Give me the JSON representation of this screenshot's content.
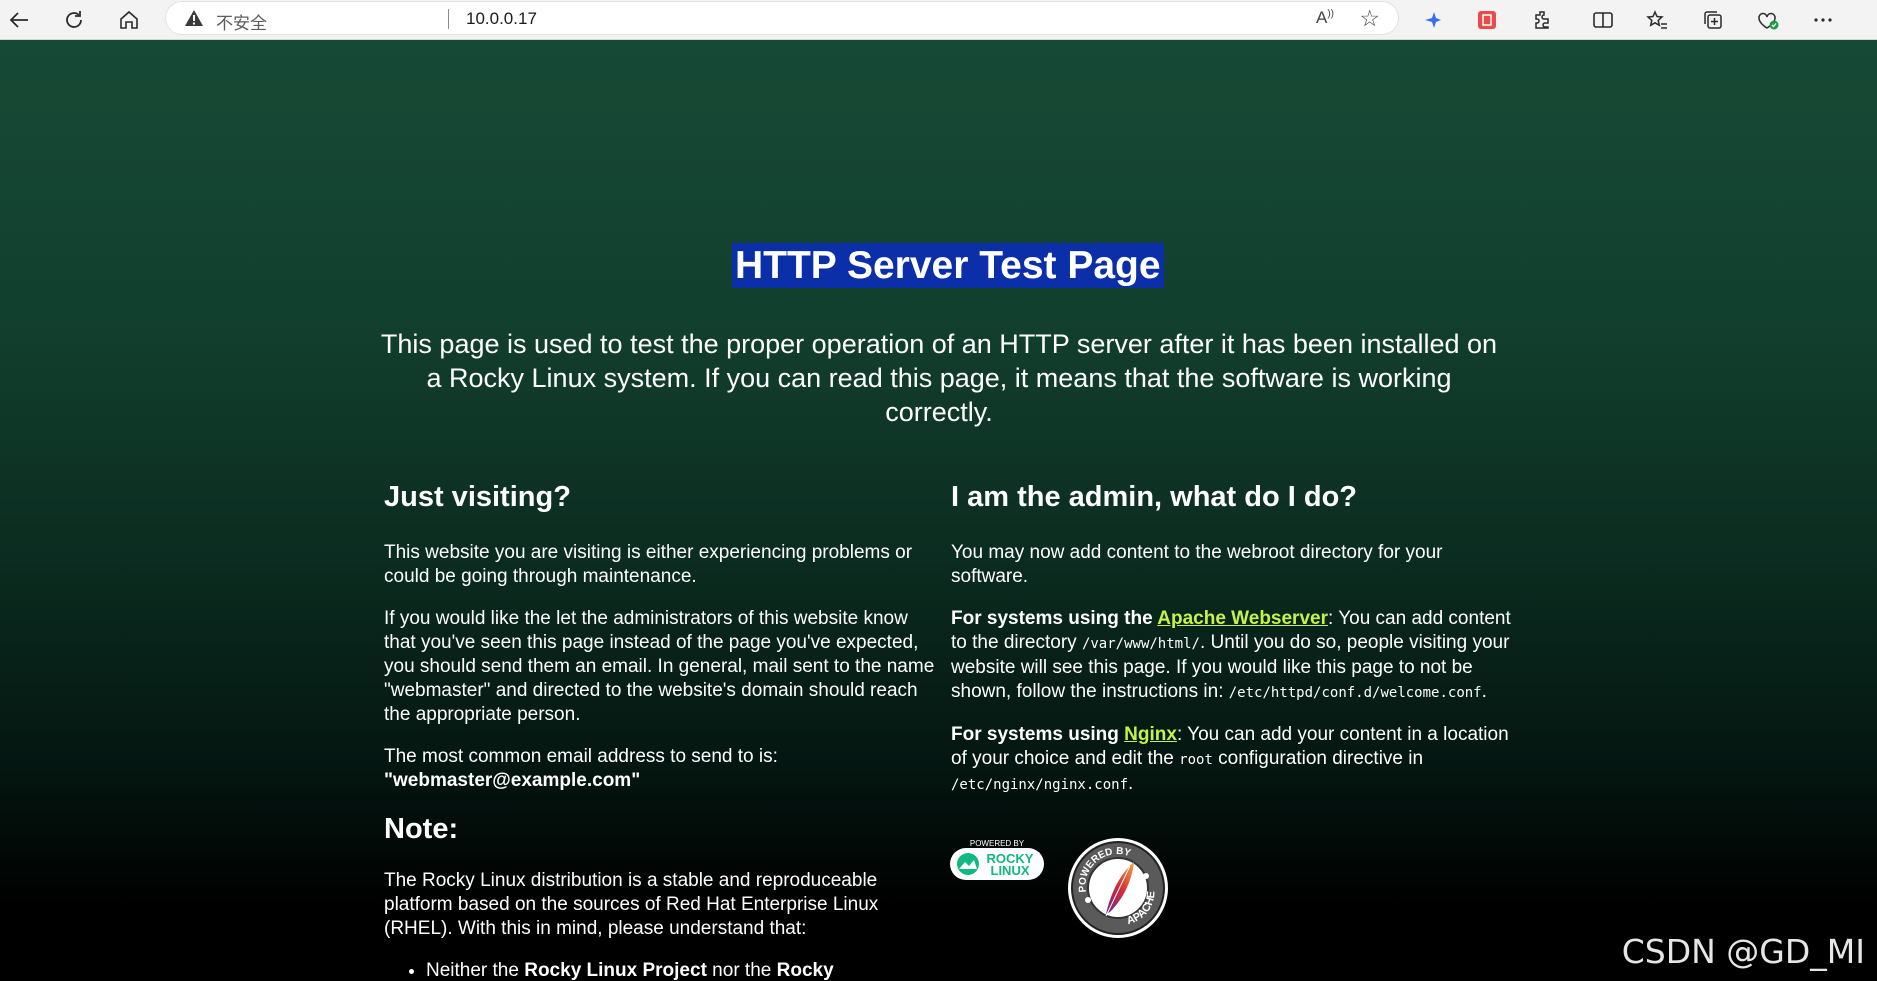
{
  "browser": {
    "security_label": "不安全",
    "url": "10.0.0.17",
    "read_aloud_label": "A",
    "icons": [
      "back-icon",
      "refresh-icon",
      "home-icon",
      "warning-icon",
      "read-aloud-icon",
      "favorite-star-icon",
      "extension-blue-icon",
      "extension-red-icon",
      "extensions-icon",
      "split-screen-icon",
      "favorites-icon",
      "collections-icon",
      "browser-essentials-icon",
      "more-icon"
    ]
  },
  "page": {
    "title": "HTTP Server Test Page",
    "intro": "This page is used to test the proper operation of an HTTP server after it has been installed on a Rocky Linux system. If you can read this page, it means that the software is working correctly.",
    "left": {
      "heading": "Just visiting?",
      "p1": "This website you are visiting is either experiencing problems or could be going through maintenance.",
      "p2": "If you would like the let the administrators of this website know that you've seen this page instead of the page you've expected, you should send them an email. In general, mail sent to the name \"webmaster\" and directed to the website's domain should reach the appropriate person.",
      "p3_lead": "The most common email address to send to is:",
      "email": "\"webmaster@example.com\"",
      "note_heading": "Note:",
      "note_p": "The Rocky Linux distribution is a stable and reproduceable platform based on the sources of Red Hat Enterprise Linux (RHEL). With this in mind, please understand that:",
      "bullet_1_a": "Neither the ",
      "bullet_1_b": "Rocky Linux Project",
      "bullet_1_c": " nor the ",
      "bullet_1_d": "Rocky"
    },
    "right": {
      "heading": "I am the admin, what do I do?",
      "p1": "You may now add content to the webroot directory for your software.",
      "apache_lead": "For systems using the ",
      "apache_link": "Apache Webserver",
      "apache_text_1": ": You can add content to the directory ",
      "apache_dir": "/var/www/html/",
      "apache_text_2": ". Until you do so, people visiting your website will see this page. If you would like this page to not be shown, follow the instructions in: ",
      "apache_conf": "/etc/httpd/conf.d/welcome.conf",
      "apache_end": ".",
      "nginx_lead": "For systems using ",
      "nginx_link": "Nginx",
      "nginx_text_1": ": You can add your content in a location of your choice and edit the ",
      "nginx_root": "root",
      "nginx_text_2": " configuration directive in ",
      "nginx_conf": "/etc/nginx/nginx.conf",
      "nginx_end": "."
    },
    "logos": {
      "rocky_powered": "POWERED BY",
      "rocky_1": "ROCKY",
      "rocky_2": "LINUX",
      "apache_powered": "POWERED BY",
      "apache_name": "APACHE"
    }
  },
  "watermark": "CSDN @GD_MI",
  "colors": {
    "link": "#c7f24b",
    "title_highlight": "#0a2fa8",
    "bg_top": "#174a36",
    "bg_bottom": "#000000"
  }
}
